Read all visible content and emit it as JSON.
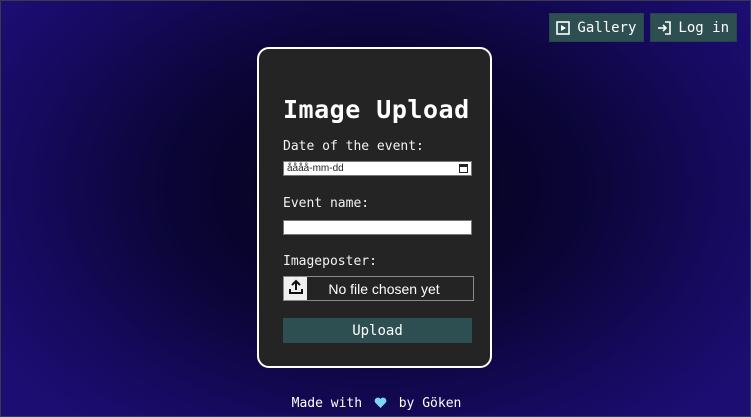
{
  "nav": {
    "gallery_label": "Gallery",
    "gallery_icon": "play-square-icon",
    "login_label": "Log in",
    "login_icon": "login-arrow-icon"
  },
  "form": {
    "title": "Image Upload",
    "date_label": "Date of the event:",
    "date_placeholder": "åååå-mm-dd",
    "name_label": "Event name:",
    "name_value": "",
    "poster_label": "Imageposter:",
    "file_status": "No file chosen yet",
    "upload_label": "Upload"
  },
  "footer": {
    "prefix": "Made with",
    "suffix": "by Göken",
    "heart_icon": "heart-icon"
  },
  "colors": {
    "button_bg": "#2d4f52",
    "card_bg": "#242424",
    "heart": "#7fd6f0"
  }
}
